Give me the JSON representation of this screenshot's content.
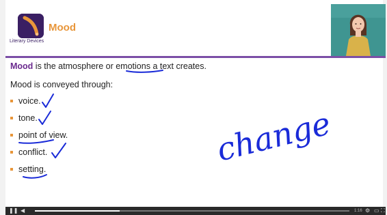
{
  "lesson": {
    "title": "Mood",
    "logo_label": "Literary Devices"
  },
  "slide": {
    "definition": {
      "keyword": "Mood",
      "pre": " is the atmosphere or ",
      "emph": "emotions",
      "post": " a text creates."
    },
    "intro": "Mood is conveyed through:",
    "bullets": [
      "voice.",
      "tone.",
      "point of view.",
      "conflict.",
      "setting."
    ]
  },
  "annotation": {
    "handwritten_word": "change"
  },
  "player": {
    "progress_fraction": 0.27,
    "time_text": "1:16"
  },
  "colors": {
    "accent_orange": "#e8963a",
    "brand_purple": "#6a2a8e",
    "ink_blue": "#1a2bd8"
  }
}
